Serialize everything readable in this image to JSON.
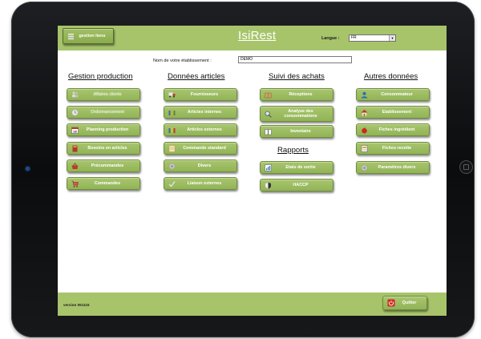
{
  "header": {
    "links_button_label": "gestion liens",
    "app_title": "IsiRest",
    "language_label": "Langue :",
    "language_selected": "FR"
  },
  "establishment": {
    "label": "Nom de votre établissement :",
    "value": "DEMO"
  },
  "sections": {
    "production": {
      "title": "Gestion production",
      "items": [
        "Affaires clients",
        "Ordonnancement",
        "Planning production",
        "Besoins en articles",
        "Précommandes",
        "Commandes"
      ]
    },
    "articles": {
      "title": "Données articles",
      "items": [
        "Fournisseurs",
        "Articles internes",
        "Articles externes",
        "Commande standard",
        "Divers",
        "Liaison externes"
      ]
    },
    "achats": {
      "title": "Suivi des achats",
      "items": [
        "Réceptions",
        "Analyse des consommations",
        "Inventaire"
      ]
    },
    "rapports": {
      "title": "Rapports",
      "items": [
        "Etats de sortie",
        "HACCP"
      ]
    },
    "autres": {
      "title": "Autres données",
      "items": [
        "Consommateur",
        "Etablissement",
        "Fiches ingrédient",
        "Fiches recette",
        "Paramètres divers"
      ]
    }
  },
  "footer": {
    "version": "version 051115",
    "quit_label": "Quitter"
  },
  "colors": {
    "accent_green": "#a7c46b",
    "button_green": "#91b356",
    "tablet_frame": "#111214"
  },
  "icons": [
    "menu-icon",
    "people-icon",
    "clock-icon",
    "calendar-icon",
    "book-icon",
    "basket-icon",
    "cart-icon",
    "truck-icon",
    "bottles-icon",
    "notepad-icon",
    "gear-icon",
    "check-icon",
    "box-icon",
    "magnifier-icon",
    "book-open-icon",
    "chart-icon",
    "shield-icon",
    "person-icon",
    "house-icon",
    "apple-icon",
    "recipe-icon",
    "power-icon"
  ]
}
